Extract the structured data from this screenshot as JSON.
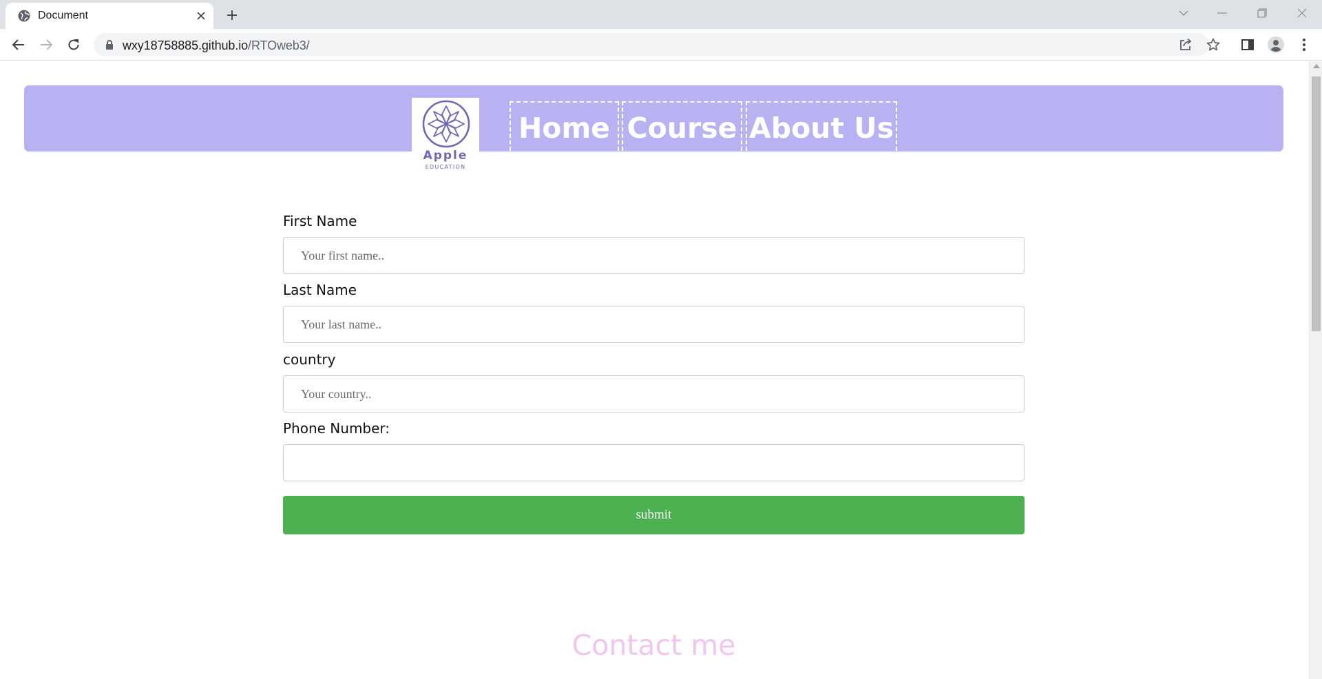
{
  "browser": {
    "tab_title": "Document",
    "url_host": "wxy18758885.github.io",
    "url_path": "/RTOweb3/"
  },
  "logo": {
    "name": "Apple",
    "subtitle": "EDUCATION",
    "color": "#6e68b0"
  },
  "nav": {
    "items": [
      {
        "label": "Home"
      },
      {
        "label": "Course"
      },
      {
        "label": "About Us"
      }
    ],
    "background": "#b9b2f2"
  },
  "form": {
    "first_name": {
      "label": "First Name",
      "placeholder": "Your first name..",
      "value": ""
    },
    "last_name": {
      "label": "Last Name",
      "placeholder": "Your last name..",
      "value": ""
    },
    "country": {
      "label": "country",
      "placeholder": "Your country..",
      "value": ""
    },
    "phone": {
      "label": "Phone Number:",
      "placeholder": "",
      "value": ""
    },
    "submit_label": "submit",
    "submit_color": "#4caf50"
  },
  "contact": {
    "heading": "Contact me",
    "color": "#f0c6ef"
  }
}
